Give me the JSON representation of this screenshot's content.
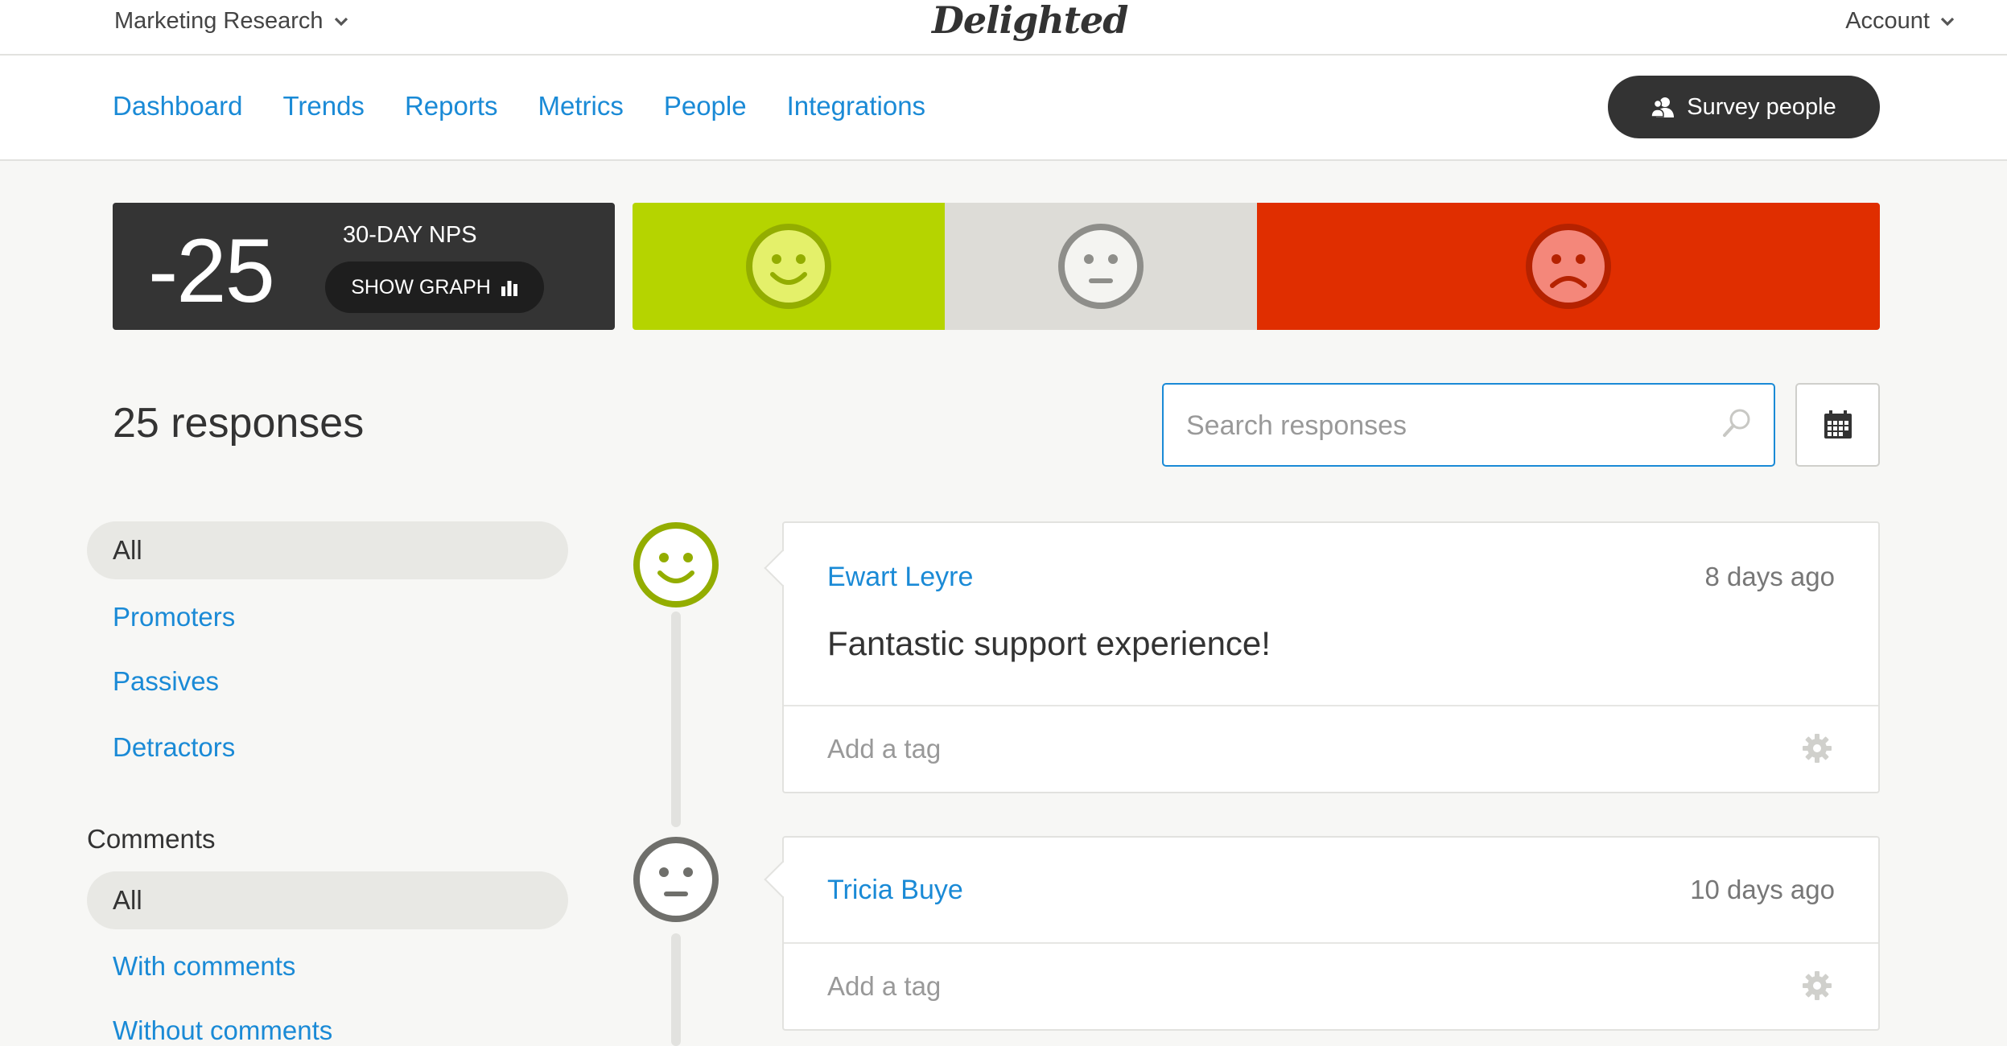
{
  "header": {
    "project": "Marketing Research",
    "logo": "Delighted",
    "account": "Account"
  },
  "nav": {
    "items": [
      "Dashboard",
      "Trends",
      "Reports",
      "Metrics",
      "People",
      "Integrations"
    ],
    "survey_button": "Survey people"
  },
  "nps": {
    "score": "-25",
    "label": "30-DAY NPS",
    "show_graph": "SHOW GRAPH"
  },
  "segments": {
    "promoter_color": "#b5d400",
    "passive_color": "#dddcd7",
    "detractor_color": "#e02e00"
  },
  "responses": {
    "count_label": "25 responses",
    "search_placeholder": "Search responses"
  },
  "sidebar": {
    "score_filters": [
      "All",
      "Promoters",
      "Passives",
      "Detractors"
    ],
    "comments_label": "Comments",
    "comment_filters": [
      "All",
      "With comments",
      "Without comments"
    ]
  },
  "cards": [
    {
      "name": "Ewart Leyre",
      "time": "8 days ago",
      "comment": "Fantastic support experience!",
      "tag_placeholder": "Add a tag",
      "sentiment": "promoter"
    },
    {
      "name": "Tricia Buye",
      "time": "10 days ago",
      "comment": "",
      "tag_placeholder": "Add a tag",
      "sentiment": "passive"
    }
  ],
  "colors": {
    "link": "#1a8ad6",
    "dark": "#343434"
  }
}
